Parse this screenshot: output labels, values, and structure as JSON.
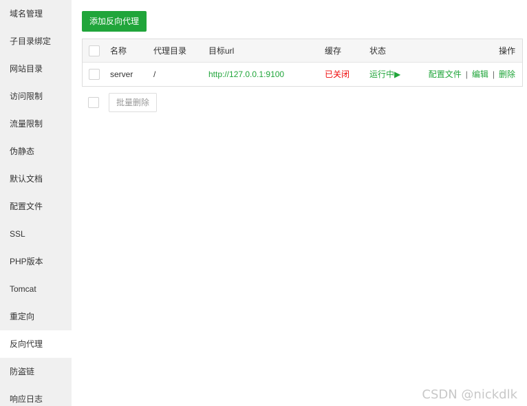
{
  "sidebar": {
    "items": [
      {
        "label": "域名管理"
      },
      {
        "label": "子目录绑定"
      },
      {
        "label": "网站目录"
      },
      {
        "label": "访问限制"
      },
      {
        "label": "流量限制"
      },
      {
        "label": "伪静态"
      },
      {
        "label": "默认文档"
      },
      {
        "label": "配置文件"
      },
      {
        "label": "SSL"
      },
      {
        "label": "PHP版本"
      },
      {
        "label": "Tomcat"
      },
      {
        "label": "重定向"
      },
      {
        "label": "反向代理"
      },
      {
        "label": "防盗链"
      },
      {
        "label": "响应日志"
      }
    ],
    "active_index": 12
  },
  "toolbar": {
    "add_label": "添加反向代理"
  },
  "table": {
    "headers": {
      "name": "名称",
      "path": "代理目录",
      "url": "目标url",
      "cache": "缓存",
      "state": "状态",
      "ops": "操作"
    },
    "rows": [
      {
        "name": "server",
        "path": "/",
        "url": "http://127.0.0.1:9100",
        "cache": "已关闭",
        "state": "运行中▶",
        "ops": {
          "config": "配置文件",
          "sep1": "|",
          "edit": "编辑",
          "sep2": "|",
          "delete": "删除"
        }
      }
    ]
  },
  "footer": {
    "batch_delete": "批量删除"
  },
  "watermark": "CSDN @nickdlk",
  "colors": {
    "accent": "#20a53a",
    "danger": "#ef0808",
    "sidebar_bg": "#f0f0f0"
  }
}
